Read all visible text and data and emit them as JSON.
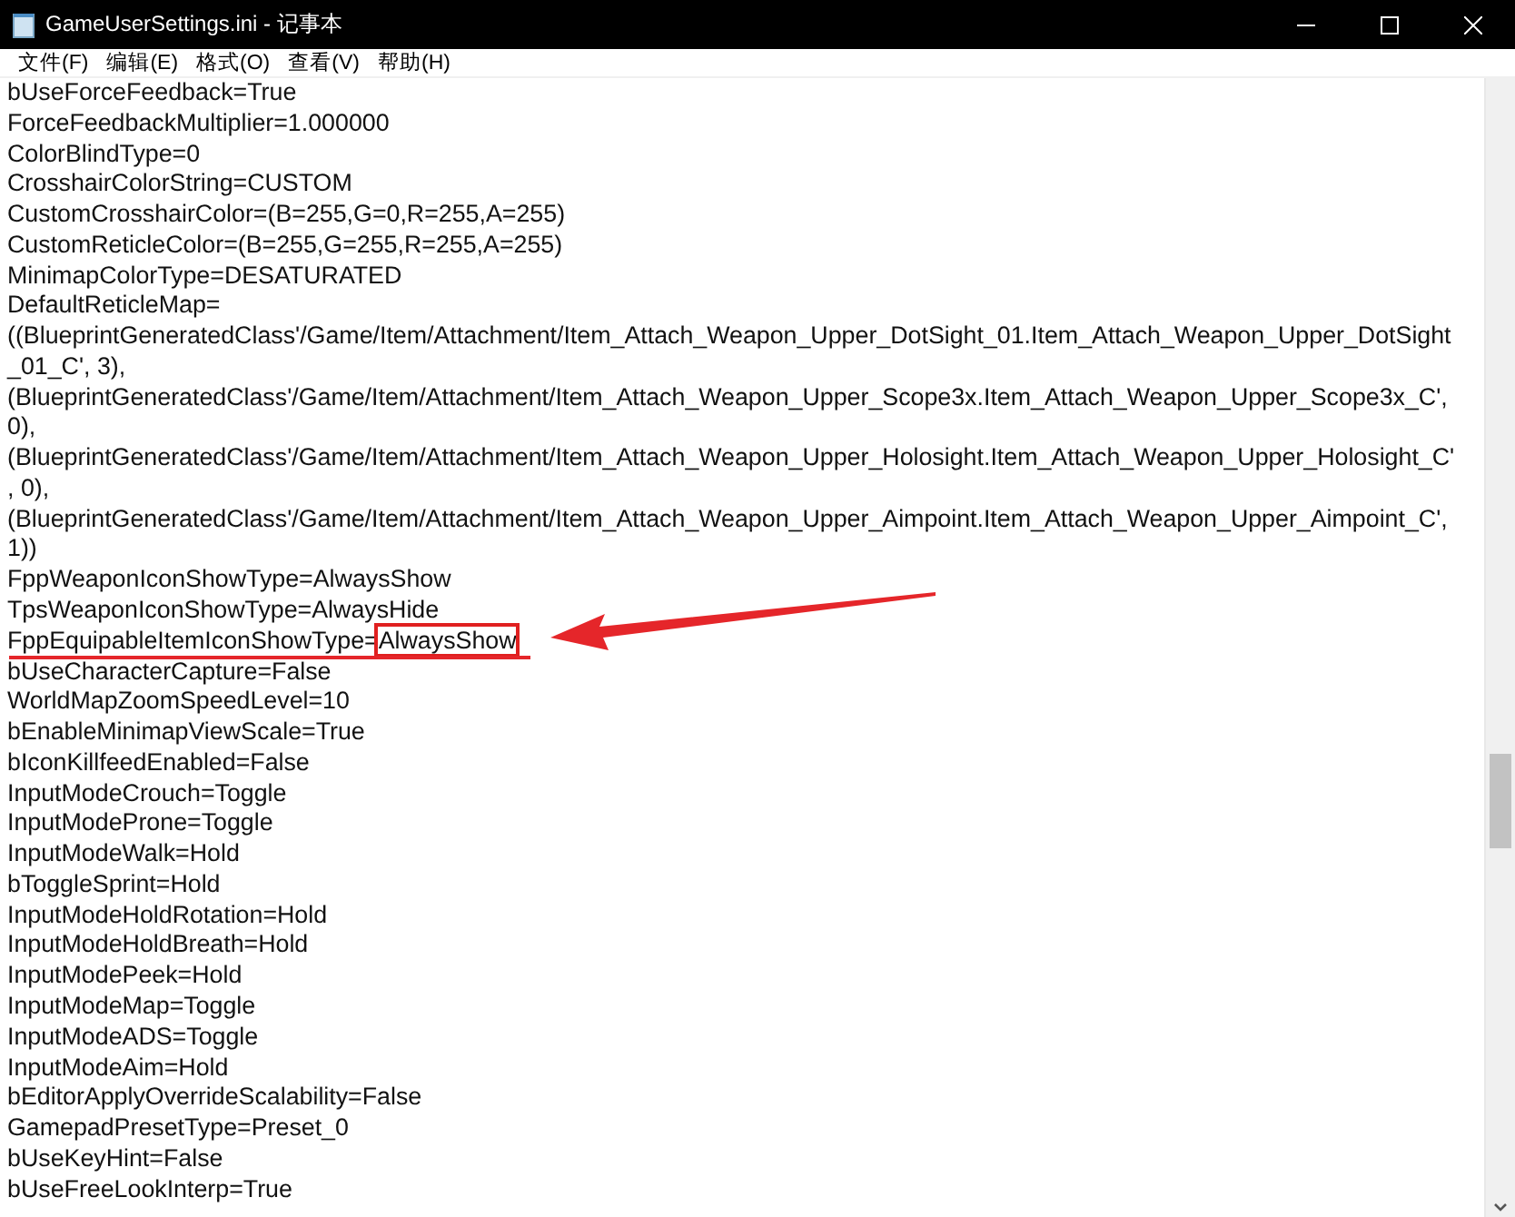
{
  "window": {
    "title": "GameUserSettings.ini - 记事本"
  },
  "menu": [
    "文件(F)",
    "编辑(E)",
    "格式(O)",
    "查看(V)",
    "帮助(H)"
  ],
  "lines": [
    {
      "text": "bUseForceFeedback=True"
    },
    {
      "text": "ForceFeedbackMultiplier=1.000000"
    },
    {
      "text": "ColorBlindType=0"
    },
    {
      "text": "CrosshairColorString=CUSTOM"
    },
    {
      "text": "CustomCrosshairColor=(B=255,G=0,R=255,A=255)"
    },
    {
      "text": "CustomReticleColor=(B=255,G=255,R=255,A=255)"
    },
    {
      "text": "MinimapColorType=DESATURATED"
    },
    {
      "text": "DefaultReticleMap="
    },
    {
      "text": "((BlueprintGeneratedClass'/Game/Item/Attachment/Item_Attach_Weapon_Upper_DotSight_01.Item_Attach_Weapon_Upper_DotSight"
    },
    {
      "text": "_01_C', 3),"
    },
    {
      "text": "(BlueprintGeneratedClass'/Game/Item/Attachment/Item_Attach_Weapon_Upper_Scope3x.Item_Attach_Weapon_Upper_Scope3x_C',"
    },
    {
      "text": "0),"
    },
    {
      "text": "(BlueprintGeneratedClass'/Game/Item/Attachment/Item_Attach_Weapon_Upper_Holosight.Item_Attach_Weapon_Upper_Holosight_C'"
    },
    {
      "text": ", 0),"
    },
    {
      "text": "(BlueprintGeneratedClass'/Game/Item/Attachment/Item_Attach_Weapon_Upper_Aimpoint.Item_Attach_Weapon_Upper_Aimpoint_C',"
    },
    {
      "text": "1))"
    },
    {
      "text": "FppWeaponIconShowType=AlwaysShow"
    },
    {
      "text": "TpsWeaponIconShowType=AlwaysHide"
    },
    {
      "text": "FppEquipableItemIconShowType=",
      "boxed": "AlwaysShow"
    },
    {
      "text": "bUseCharacterCapture=False"
    },
    {
      "text": "WorldMapZoomSpeedLevel=10"
    },
    {
      "text": "bEnableMinimapViewScale=True"
    },
    {
      "text": "bIconKillfeedEnabled=False"
    },
    {
      "text": "InputModeCrouch=Toggle"
    },
    {
      "text": "InputModeProne=Toggle"
    },
    {
      "text": "InputModeWalk=Hold"
    },
    {
      "text": "bToggleSprint=Hold"
    },
    {
      "text": "InputModeHoldRotation=Hold"
    },
    {
      "text": "InputModeHoldBreath=Hold"
    },
    {
      "text": "InputModePeek=Hold"
    },
    {
      "text": "InputModeMap=Toggle"
    },
    {
      "text": "InputModeADS=Toggle"
    },
    {
      "text": "InputModeAim=Hold"
    },
    {
      "text": "bEditorApplyOverrideScalability=False"
    },
    {
      "text": "GamepadPresetType=Preset_0"
    },
    {
      "text": "bUseKeyHint=False"
    },
    {
      "text": "bUseFreeLookInterp=True"
    }
  ]
}
